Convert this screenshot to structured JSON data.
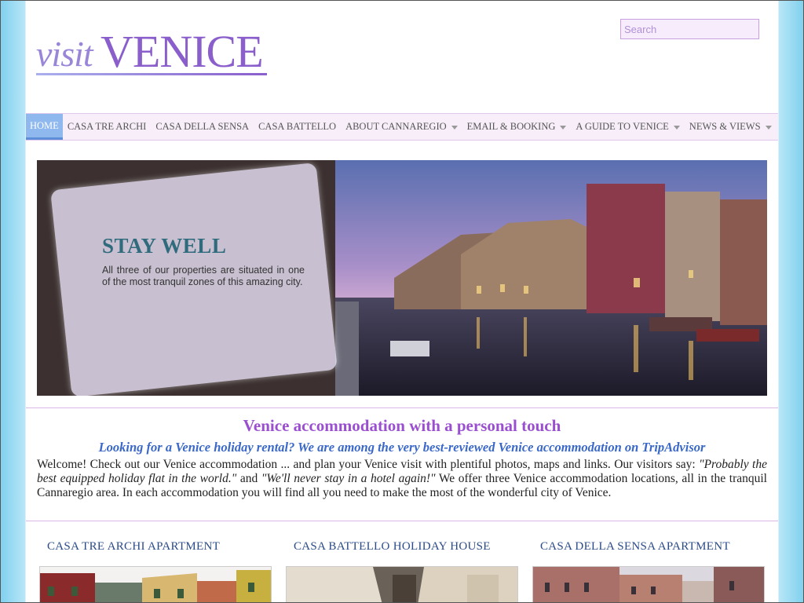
{
  "logo": {
    "visit": "visit",
    "venice": "VENICE"
  },
  "search": {
    "placeholder": "Search"
  },
  "nav": {
    "items": [
      {
        "label": "HOME",
        "active": true
      },
      {
        "label": "CASA TRE ARCHI"
      },
      {
        "label": "CASA DELLA SENSA"
      },
      {
        "label": "CASA BATTELLO"
      },
      {
        "label": "ABOUT CANNAREGIO",
        "dropdown": true
      },
      {
        "label": "EMAIL & BOOKING",
        "dropdown": true
      },
      {
        "label": "A GUIDE TO VENICE",
        "dropdown": true
      },
      {
        "label": "NEWS & VIEWS",
        "dropdown": true
      }
    ]
  },
  "hero": {
    "title": "STAY WELL",
    "text": "All three of our properties are situated in one of the most tranquil zones of this amazing city."
  },
  "welcome": {
    "title": "Venice accommodation with a personal touch",
    "subtitle": "Looking for a Venice holiday rental? We are among the very best-reviewed Venice accommodation on TripAdvisor",
    "body_1": "Welcome! Check out our Venice accommodation ... and plan your Venice visit with plentiful photos, maps and links. Our visitors say: ",
    "quote_1": "\"Probably the best equipped holiday flat in the world.\"",
    "body_2": " and ",
    "quote_2": "\"We'll never stay in a hotel again!\"",
    "body_3": " We offer three Venice accommodation locations, all in the tranquil Cannaregio area. In each accommodation you will find all you need to make the most of the wonderful city of Venice."
  },
  "properties": [
    {
      "title": "CASA TRE ARCHI APARTMENT"
    },
    {
      "title": "CASA BATTELLO HOLIDAY HOUSE"
    },
    {
      "title": "CASA DELLA SENSA APARTMENT"
    }
  ],
  "colors": {
    "accent": "#9a4fd0",
    "link_blue": "#3a68c8",
    "nav_bg": "#f7eef9",
    "nav_active": "#8fb8ee",
    "hero_title": "#2f6b7c"
  }
}
